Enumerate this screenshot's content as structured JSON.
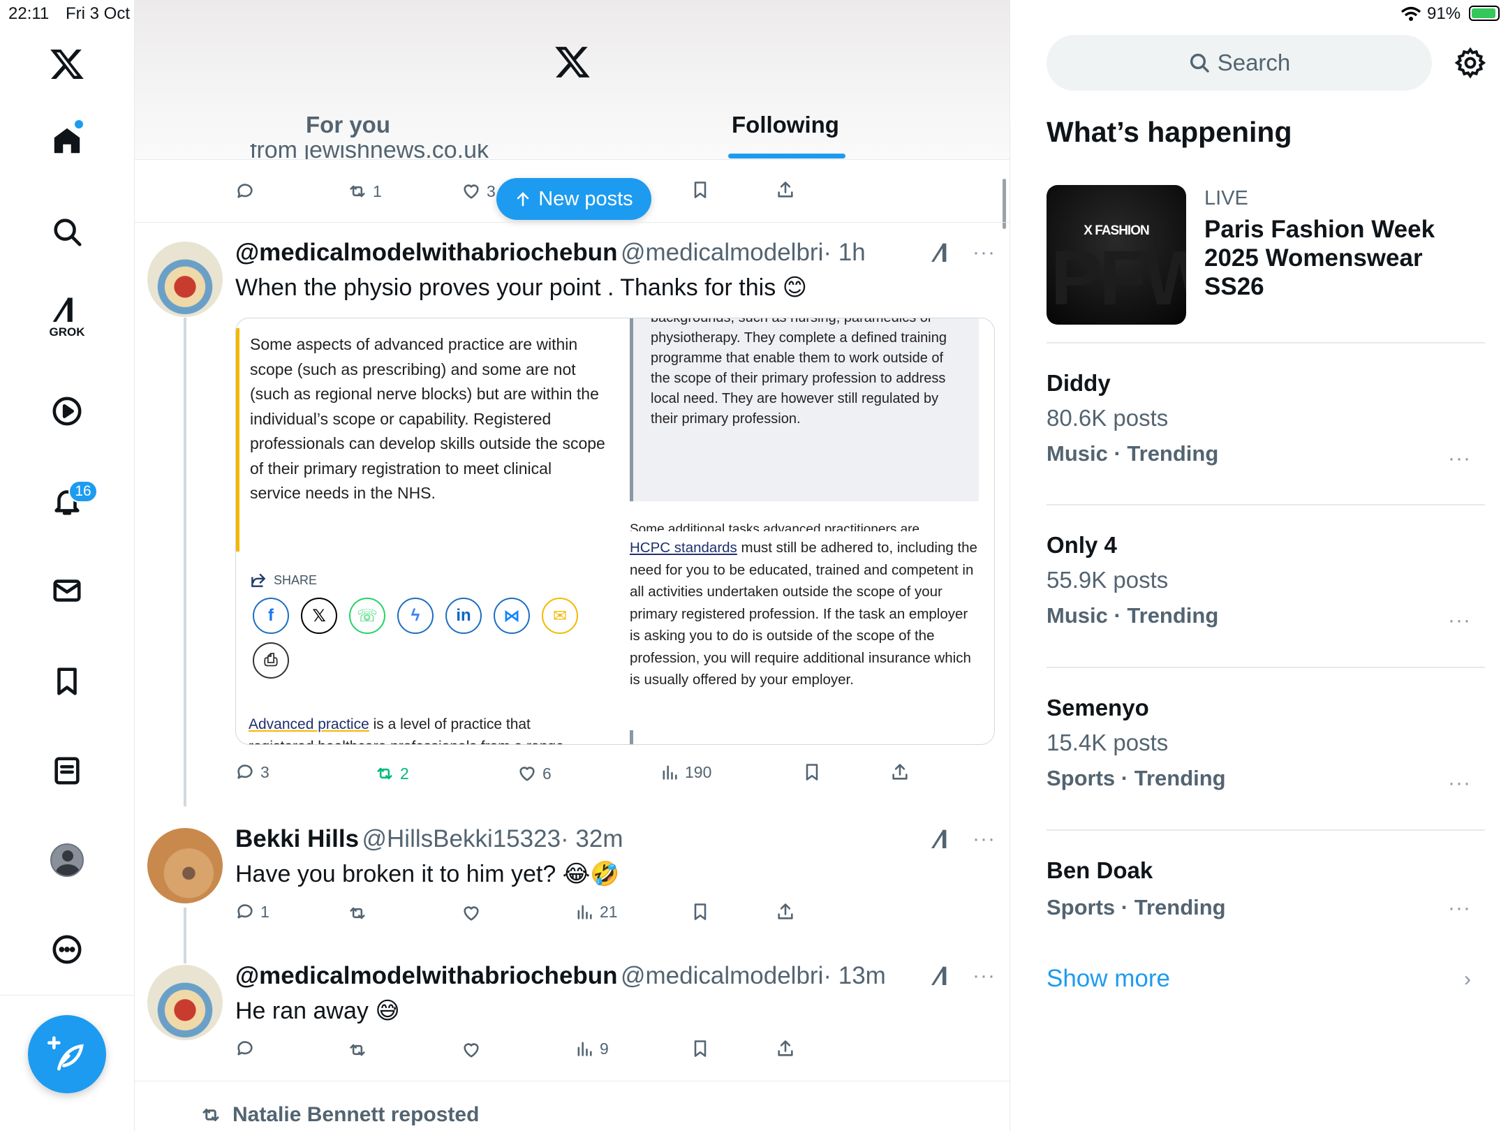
{
  "status_bar": {
    "time": "22:11",
    "date": "Fri 3 Oct",
    "battery": "91%",
    "dots": "•••"
  },
  "sidebar": {
    "grok_label": "GROK",
    "notifications_badge": "16",
    "items": [
      "x-logo",
      "home",
      "search",
      "grok",
      "video",
      "notifications",
      "messages",
      "bookmarks",
      "lists",
      "profile",
      "more"
    ]
  },
  "header": {
    "tabs": [
      {
        "label": "For you",
        "active": false
      },
      {
        "label": "Following",
        "active": true
      }
    ],
    "new_posts_label": "New posts",
    "cut_text": "from jewishnews.co.uk"
  },
  "top_post_actions": {
    "replies": "",
    "reposts": "1",
    "likes": "3"
  },
  "posts": [
    {
      "name": "@medicalmodelwithabriochebun",
      "handle": "@medicalmodelbri",
      "time": "· 1h",
      "text": "When the physio proves your point . Thanks for this 😊",
      "replies": "3",
      "reposts": "2",
      "likes": "6",
      "views": "190"
    },
    {
      "name": "Bekki Hills",
      "handle": "@HillsBekki15323",
      "time": "· 32m",
      "text": "Have you broken it to him yet? 😂🤣",
      "replies": "1",
      "reposts": "",
      "likes": "",
      "views": "21"
    },
    {
      "name": "@medicalmodelwithabriochebun",
      "handle": "@medicalmodelbri",
      "time": "· 13m",
      "text": "He ran away 😅",
      "replies": "",
      "reposts": "",
      "likes": "",
      "views": "9"
    }
  ],
  "embed": {
    "quote_left": "Some aspects of advanced practice are within scope (such as prescribing) and some are not (such as regional nerve blocks) but are within the individual’s scope or capability. Registered professionals can develop skills outside the scope of their primary registration to meet clinical service needs in the NHS.",
    "share_label": "SHARE",
    "advanced_link": "Advanced practice",
    "advanced_rest": " is a level of practice that",
    "advanced_cut": "registered healthcare professionals from a range",
    "right_box": "backgrounds, such as nursing, paramedics or physiotherapy. They complete a defined training programme that enable them to work outside of the scope of their primary profession to address local need. They are however still regulated by their primary profession.",
    "additional_cut": "Some additional tasks advanced practitioners are",
    "hcpc_link": "HCPC standards",
    "hcpc_rest": " must still be adhered to, including the need for you to be educated, trained and competent in all activities undertaken outside the scope of your primary registered profession. If the task an employer is asking you to do is outside of the scope of the profession, you will require additional insurance which is usually offered by your employer."
  },
  "repost_banner": "Natalie Bennett reposted",
  "right": {
    "search_placeholder": "Search",
    "section_title": "What’s happening",
    "live": {
      "tag": "LIVE",
      "title": "Paris Fashion Week 2025 Womenswear SS26",
      "thumb_label": "X FASHION",
      "thumb_bg": "PFW"
    },
    "trends": [
      {
        "name": "Diddy",
        "count": "80.6K posts",
        "meta": "Music · Trending"
      },
      {
        "name": "Only 4",
        "count": "55.9K posts",
        "meta": "Music · Trending"
      },
      {
        "name": "Semenyo",
        "count": "15.4K posts",
        "meta": "Sports · Trending"
      },
      {
        "name": "Ben Doak",
        "count": "",
        "meta": "Sports · Trending"
      }
    ],
    "show_more": "Show more"
  },
  "colors": {
    "accent": "#1d9bf0",
    "repost_green": "#00ba7c",
    "text": "#0f1419",
    "muted": "#536471"
  }
}
